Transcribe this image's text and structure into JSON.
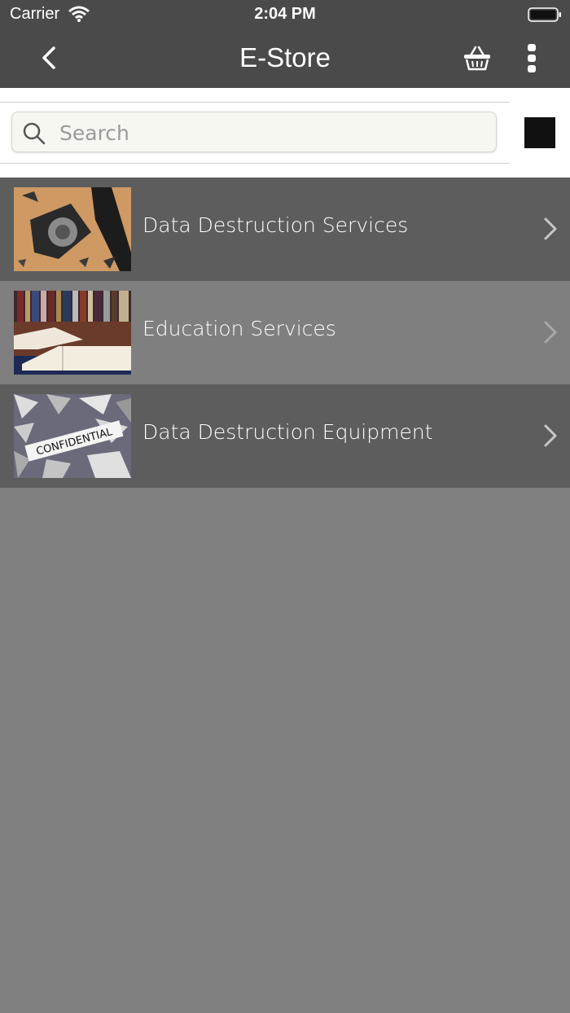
{
  "status_bar": {
    "carrier": "Carrier",
    "time": "2:04 PM"
  },
  "nav": {
    "title": "E-Store",
    "back_icon": "chevron-left-icon",
    "cart_icon": "basket-icon",
    "more_icon": "more-vertical-icon"
  },
  "search": {
    "placeholder": "Search",
    "value": ""
  },
  "view_toggle": {
    "icon": "grid-icon"
  },
  "categories": [
    {
      "label": "Data Destruction Services",
      "thumbnail": "shattered-hard-drive"
    },
    {
      "label": "Education Services",
      "thumbnail": "open-books-library"
    },
    {
      "label": "Data Destruction Equipment",
      "thumbnail": "shredded-confidential-paper",
      "thumbnail_text": "CONFIDENTIAL"
    }
  ],
  "colors": {
    "header": "#4a4a4a",
    "row_dark": "#5d5d5d",
    "row_light": "#7f7f7f",
    "background": "#808080"
  }
}
